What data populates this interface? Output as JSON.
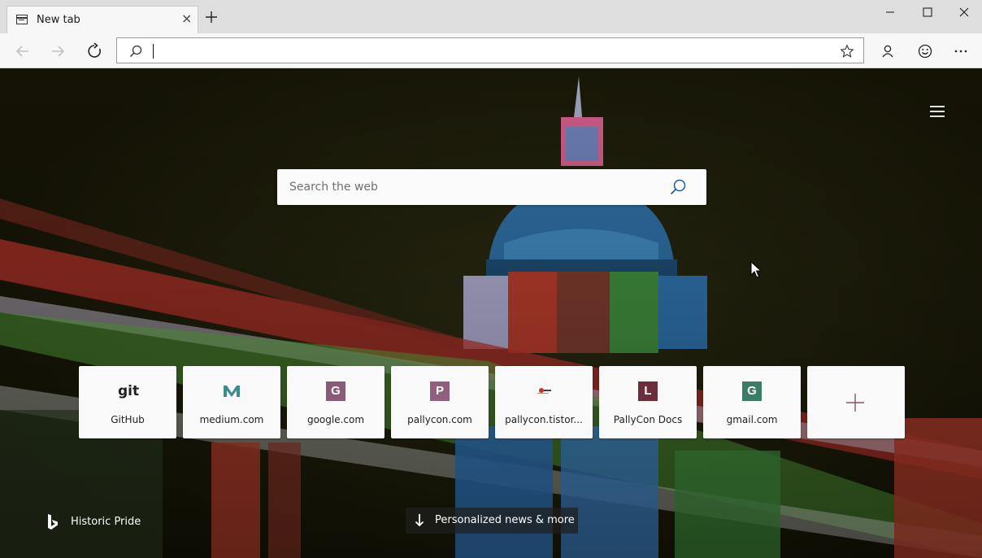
{
  "tab": {
    "title": "New tab",
    "close": "×"
  },
  "address_bar": {
    "value": ""
  },
  "search": {
    "placeholder": "Search the web"
  },
  "tiles": [
    {
      "label": "GitHub",
      "icon_text": "git",
      "icon": "github-icon"
    },
    {
      "label": "medium.com",
      "icon": "medium-icon",
      "color": "#3a8d8f"
    },
    {
      "label": "google.com",
      "icon_text": "G",
      "color": "#8a5a78"
    },
    {
      "label": "pallycon.com",
      "icon_text": "P",
      "color": "#8f5f7d"
    },
    {
      "label": "pallycon.tistor...",
      "icon": "pallycon-tistory-icon"
    },
    {
      "label": "PallyCon Docs",
      "icon_text": "L",
      "color": "#6b2e3b"
    },
    {
      "label": "gmail.com",
      "icon_text": "G",
      "color": "#3b7b68"
    }
  ],
  "footer": {
    "image_caption": "Historic Pride",
    "news_button": "Personalized news & more"
  },
  "colors": {
    "tab_bar": "#dedede",
    "toolbar": "#f7f7f7"
  }
}
